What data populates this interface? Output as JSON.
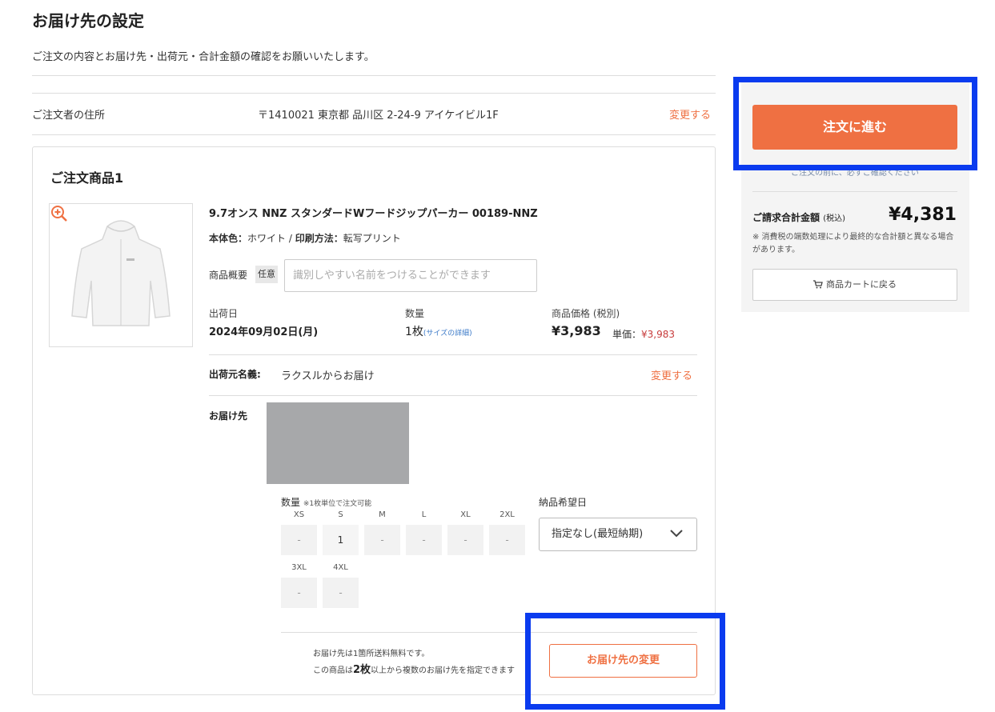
{
  "header": {
    "title": "お届け先の設定",
    "subtitle": "ご注文の内容とお届け先・出荷元・合計金額の確認をお願いいたします。"
  },
  "orderer": {
    "label": "ご注文者の住所",
    "address": "〒1410021 東京都 品川区 2-24-9 アイケイビル1F",
    "change_label": "変更する"
  },
  "item": {
    "heading": "ご注文商品1",
    "image_icon": "hoodie-image",
    "zoom_icon": "zoom-in-icon",
    "name": "9.7オンス NNZ スタンダードWフードジップパーカー 00189-NNZ",
    "color_label": "本体色：",
    "color_value": "ホワイト /",
    "print_label": "印刷方法：",
    "print_value": "転写プリント",
    "memo_label": "商品概要",
    "memo_badge": "任意",
    "memo_placeholder": "識別しやすい名前をつけることができます",
    "ship_date_label": "出荷日",
    "ship_date_value": "2024年09月02日(月)",
    "qty_label": "数量",
    "qty_value": "1枚",
    "qty_link": "(サイズの詳細)",
    "price_label": "商品価格 (税別)",
    "price_value": "¥3,983",
    "unit_price_label": "単価：",
    "unit_price_value": "¥3,983"
  },
  "shipper": {
    "label": "出荷元名義:",
    "value": "ラクスルからお届け",
    "change_label": "変更する"
  },
  "destination": {
    "label": "お届け先",
    "sizes_label": "数量",
    "sizes_note": "※1枚単位で注文可能",
    "sizes": [
      {
        "size": "XS",
        "qty": "-"
      },
      {
        "size": "S",
        "qty": "1"
      },
      {
        "size": "M",
        "qty": "-"
      },
      {
        "size": "L",
        "qty": "-"
      },
      {
        "size": "XL",
        "qty": "-"
      },
      {
        "size": "2XL",
        "qty": "-"
      },
      {
        "size": "3XL",
        "qty": "-"
      },
      {
        "size": "4XL",
        "qty": "-"
      }
    ],
    "delivery_label": "納品希望日",
    "delivery_value": "指定なし(最短納期)",
    "note_1": "お届け先は1箇所送料無料です。",
    "note_2_prefix": "この商品は",
    "note_2_count": "2枚",
    "note_2_suffix": "以上から複数のお届け先を指定できます",
    "change_button": "お届け先の変更"
  },
  "summary": {
    "order_button": "注文に進む",
    "order_note": "ご注文の前に、必ずご確認ください",
    "total_label": "ご請求合計金額",
    "total_tax": "(税込)",
    "total_value": "¥4,381",
    "total_note": "※ 消費税の端数処理により最終的な合計額と異なる場合があります。",
    "cart_button": "商品カートに戻る",
    "cart_icon": "cart-icon"
  },
  "colors": {
    "accent": "#ef7042",
    "highlight": "#0a3bef",
    "price_red": "#c73b3b",
    "link_blue": "#3b7ac8"
  }
}
